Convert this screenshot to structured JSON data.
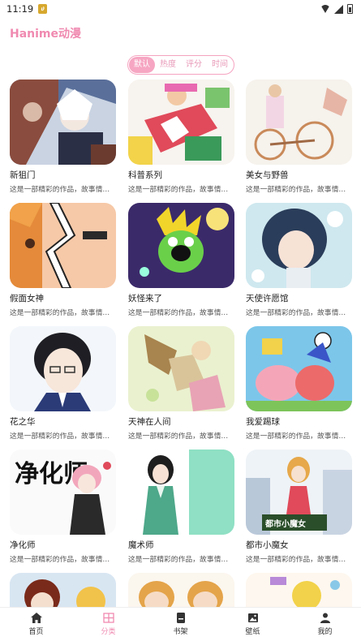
{
  "status": {
    "time": "11:19",
    "notif_glyph": "ሀ"
  },
  "app": {
    "title": "Hanime动漫"
  },
  "sort_tabs": [
    "默认",
    "热度",
    "评分",
    "时间"
  ],
  "cards": [
    {
      "title": "新狙门",
      "desc": "这是一部精彩的作品，故事情节…"
    },
    {
      "title": "科普系列",
      "desc": "这是一部精彩的作品，故事情…"
    },
    {
      "title": "美女与野兽",
      "desc": "这是一部精彩的作品，故事情节…"
    },
    {
      "title": "假面女神",
      "desc": "这是一部精彩的作品，故事情节…"
    },
    {
      "title": "妖怪来了",
      "desc": "这是一部精彩的作品，故事情…"
    },
    {
      "title": "天使许愿馆",
      "desc": "这是一部精彩的作品，故事情节…"
    },
    {
      "title": "花之华",
      "desc": "这是一部精彩的作品，故事情节…"
    },
    {
      "title": "天神在人间",
      "desc": "这是一部精彩的作品，故事情…"
    },
    {
      "title": "我爱踢球",
      "desc": "这是一部精彩的作品，故事情节…"
    },
    {
      "title": "净化师",
      "desc": "这是一部精彩的作品，故事情节…"
    },
    {
      "title": "魔术师",
      "desc": "这是一部精彩的作品，故事情…"
    },
    {
      "title": "都市小魔女",
      "desc": "这是一部精彩的作品，故事情节…"
    },
    {
      "title": "",
      "desc": ""
    },
    {
      "title": "",
      "desc": ""
    },
    {
      "title": "",
      "desc": ""
    }
  ],
  "cover_texts": {
    "purifier": "净化师",
    "witch": "都市小魔女"
  },
  "nav": [
    {
      "label": "首页",
      "icon": "home-icon"
    },
    {
      "label": "分类",
      "icon": "category-icon"
    },
    {
      "label": "书架",
      "icon": "bookshelf-icon"
    },
    {
      "label": "壁纸",
      "icon": "wallpaper-icon"
    },
    {
      "label": "我的",
      "icon": "profile-icon"
    }
  ],
  "colors": {
    "accent": "#f08ab0",
    "tab_active_bg": "#f6a6c2"
  }
}
